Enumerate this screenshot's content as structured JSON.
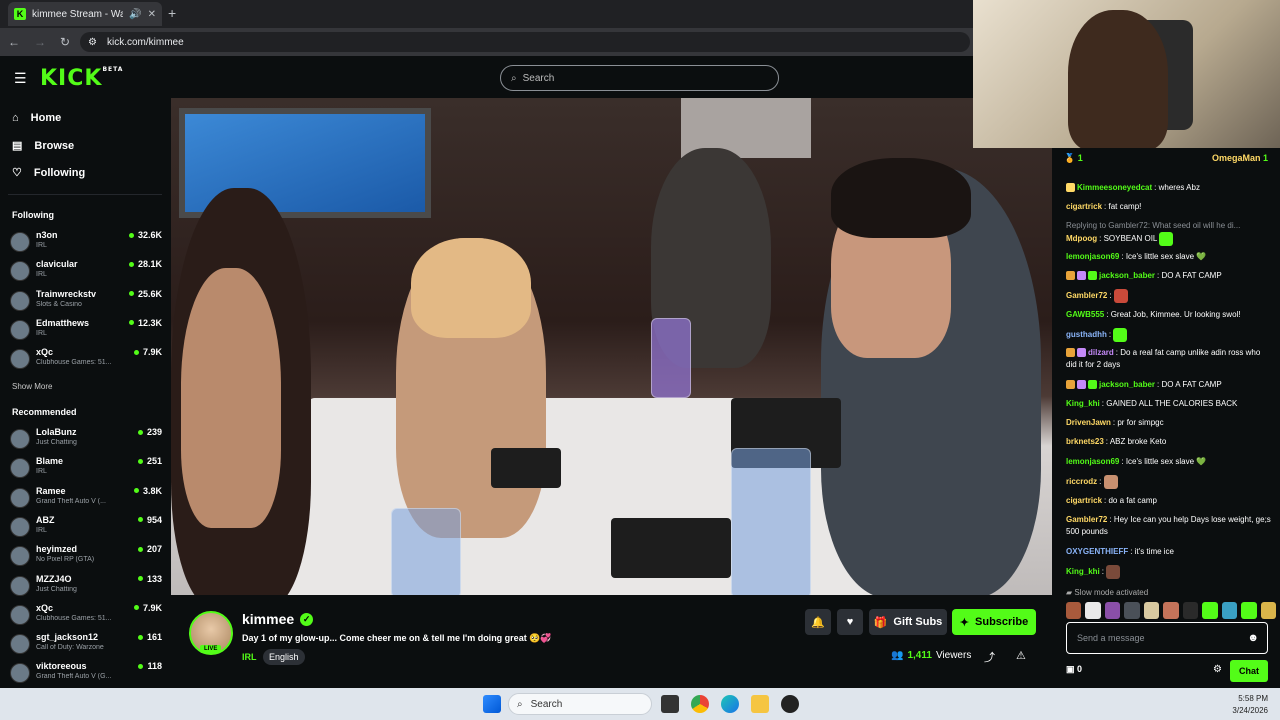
{
  "browser": {
    "tab_title": "kimmee Stream - Watch Li",
    "new_tab": "+",
    "url": "kick.com/kimmee"
  },
  "header": {
    "logo": "KICK",
    "logo_badge": "BETA",
    "search_placeholder": "Search"
  },
  "sidebar": {
    "nav": [
      {
        "label": "Home",
        "icon": "home-icon"
      },
      {
        "label": "Browse",
        "icon": "browse-icon"
      },
      {
        "label": "Following",
        "icon": "heart-icon"
      }
    ],
    "following_title": "Following",
    "following": [
      {
        "name": "n3on",
        "category": "IRL",
        "viewers": "32.6K"
      },
      {
        "name": "clavicular",
        "category": "IRL",
        "viewers": "28.1K"
      },
      {
        "name": "Trainwreckstv",
        "category": "Slots & Casino",
        "viewers": "25.6K"
      },
      {
        "name": "Edmatthews",
        "category": "IRL",
        "viewers": "12.3K"
      },
      {
        "name": "xQc",
        "category": "Clubhouse Games: 51...",
        "viewers": "7.9K"
      }
    ],
    "show_more": "Show More",
    "recommended_title": "Recommended",
    "recommended": [
      {
        "name": "LolaBunz",
        "category": "Just Chatting",
        "viewers": "239"
      },
      {
        "name": "Blame",
        "category": "IRL",
        "viewers": "251"
      },
      {
        "name": "Ramee",
        "category": "Grand Theft Auto V (...",
        "viewers": "3.8K"
      },
      {
        "name": "ABZ",
        "category": "IRL",
        "viewers": "954"
      },
      {
        "name": "heyimzed",
        "category": "No Pixel RP (GTA)",
        "viewers": "207"
      },
      {
        "name": "MZZJ4O",
        "category": "Just Chatting",
        "viewers": "133"
      },
      {
        "name": "xQc",
        "category": "Clubhouse Games: 51...",
        "viewers": "7.9K"
      },
      {
        "name": "sgt_jackson12",
        "category": "Call of Duty: Warzone",
        "viewers": "161"
      },
      {
        "name": "viktoreeous",
        "category": "Grand Theft Auto V (G...",
        "viewers": "118"
      }
    ]
  },
  "stream": {
    "streamer": "kimmee",
    "live_label": "LIVE",
    "title": "Day 1 of my glow-up... Come cheer me on & tell me I'm doing great 🥺💞",
    "category": "IRL",
    "language": "English",
    "gift_subs": "Gift Subs",
    "subscribe": "Subscribe",
    "viewers_count": "1,411",
    "viewers_label": "Viewers"
  },
  "chat": {
    "pinned_left_count": "1",
    "pinned_user": "OmegaMan",
    "pinned_right_count": "1",
    "messages": [
      {
        "user": "Kimmeesoneyedcat",
        "color": "#53fc18",
        "text": "wheres Abz",
        "badge": "star"
      },
      {
        "user": "cigartrick",
        "color": "#ffd966",
        "text": "fat camp!"
      },
      {
        "reply": "Replying to Gambler72: What seed oil will he di...",
        "user": "Mdpoog",
        "color": "#ffd966",
        "text": "SOYBEAN OIL",
        "emote": true
      },
      {
        "user": "lemonjason69",
        "color": "#53fc18",
        "text": "Ice's little sex slave 💚"
      },
      {
        "user": "jackson_baber",
        "color": "#53fc18",
        "text": "DO A FAT CAMP",
        "badges": 3
      },
      {
        "user": "Gambler72",
        "color": "#ffd966",
        "text": "",
        "emote": true
      },
      {
        "user": "GAWB555",
        "color": "#53fc18",
        "text": "Great Job, Kimmee. Ur looking swol!"
      },
      {
        "user": "gusthadhh",
        "color": "#8ab4f8",
        "text": "",
        "emote": true
      },
      {
        "user": "dilzard",
        "color": "#c58af9",
        "text": "Do a real fat camp unlike adin ross who did it for 2 days",
        "badges": 2
      },
      {
        "user": "jackson_baber",
        "color": "#53fc18",
        "text": "DO A FAT CAMP",
        "badges": 3
      },
      {
        "user": "King_khi",
        "color": "#53fc18",
        "text": "GAINED ALL THE CALORIES BACK"
      },
      {
        "user": "DrivenJawn",
        "color": "#ffd966",
        "text": "pr for simpgc"
      },
      {
        "user": "brknets23",
        "color": "#ffd966",
        "text": "ABZ broke Keto"
      },
      {
        "user": "lemonjason69",
        "color": "#53fc18",
        "text": "Ice's little sex slave 💚"
      },
      {
        "user": "riccrodz",
        "color": "#ffd966",
        "text": "",
        "emote": true
      },
      {
        "user": "cigartrick",
        "color": "#ffd966",
        "text": "do a fat camp"
      },
      {
        "user": "Gambler72",
        "color": "#ffd966",
        "text": "Hey Ice can you help Days lose weight, ge;s 500 pounds"
      },
      {
        "user": "OXYGENTHIEFF",
        "color": "#8ab4f8",
        "text": "it's time ice"
      },
      {
        "user": "King_khi",
        "color": "#53fc18",
        "text": "",
        "emote": true
      }
    ],
    "slow_mode": "Slow mode activated",
    "input_placeholder": "Send a message",
    "points": "0",
    "chat_button": "Chat"
  },
  "taskbar": {
    "search": "Search",
    "time": "5:58 PM",
    "date": "3/24/2026"
  }
}
